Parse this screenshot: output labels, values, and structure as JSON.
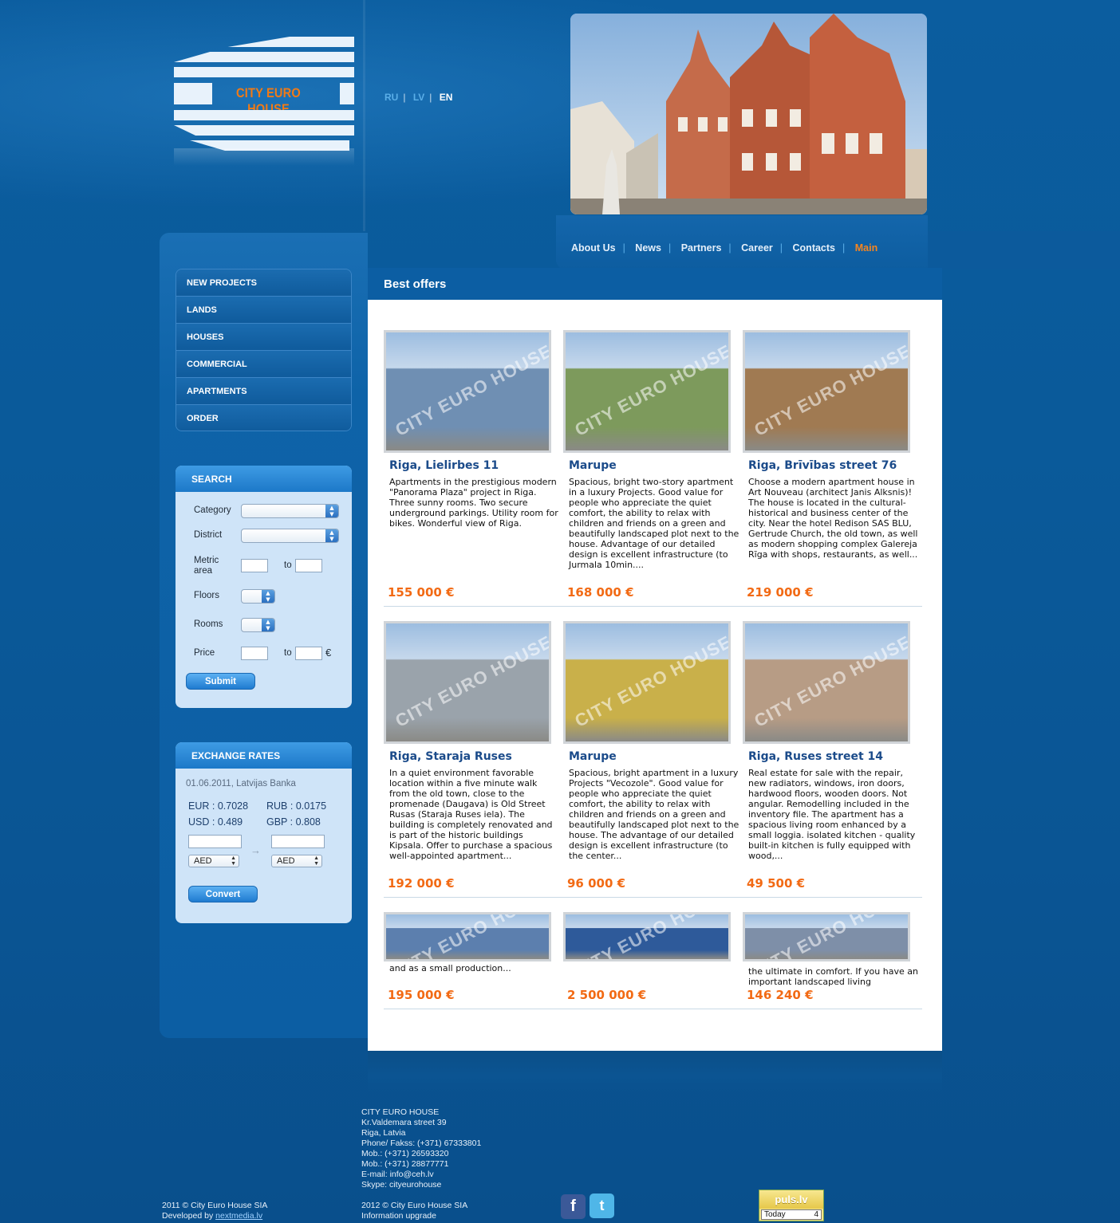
{
  "brand": {
    "logo_text": "CITY EURO HOUSE"
  },
  "languages": [
    "RU",
    "LV",
    "EN"
  ],
  "active_language": "EN",
  "nav": {
    "items": [
      "About Us",
      "News",
      "Partners",
      "Career",
      "Contacts",
      "Main"
    ],
    "active": "Main"
  },
  "categories": [
    "NEW PROJECTS",
    "LANDS",
    "HOUSES",
    "COMMERCIAL",
    "APARTMENTS",
    "ORDER"
  ],
  "search": {
    "title": "SEARCH",
    "category_label": "Category",
    "district_label": "District",
    "metric_label_1": "Metric",
    "metric_label_2": "area",
    "to_label": "to",
    "floors_label": "Floors",
    "rooms_label": "Rooms",
    "price_label": "Price",
    "currency_symbol": "€",
    "submit_label": "Submit"
  },
  "exchange": {
    "title": "EXCHANGE RATES",
    "source": "01.06.2011, Latvijas Banka",
    "rates": [
      {
        "code": "EUR",
        "value": "0.7028"
      },
      {
        "code": "RUB",
        "value": "0.0175"
      },
      {
        "code": "USD",
        "value": "0.489"
      },
      {
        "code": "GBP",
        "value": "0.808"
      }
    ],
    "from_currency": "AED",
    "to_currency": "AED",
    "arrow": "→",
    "convert_label": "Convert"
  },
  "best_offers_title": "Best offers",
  "watermark": "CITY EURO HOUSE",
  "offers": [
    {
      "title": "Riga, Lielirbes 11",
      "desc": "Apartments in the prestigious modern \"Panorama Plaza\" project in Riga. Three sunny rooms. Two secure underground parkings. Utility room for bikes. Wonderful view of Riga.",
      "price": "155 000 €",
      "tone": "#6f8fb3"
    },
    {
      "title": "Marupe",
      "desc": "Spacious, bright two-story apartment in a luxury Projects. Good value for people who appreciate the quiet comfort, the ability to relax with children and friends on a green and beautifully landscaped plot next to the house. Advantage of our detailed design is excellent infrastructure (to Jurmala 10min....",
      "price": "168 000 €",
      "tone": "#7d9a5c"
    },
    {
      "title": "Riga, Brīvības street 76",
      "desc": "Choose a modern apartment house in Art Nouveau (architect Janis Alksnis)! The house is located in the cultural-historical and business center of the city. Near the hotel Redison SAS BLU, Gertrude Church, the old town, as well as modern shopping complex Galereja Rīga with shops, restaurants, as well...",
      "price": "219 000 €",
      "tone": "#a07a52"
    },
    {
      "title": "Riga, Staraja Ruses",
      "desc": "In a quiet environment favorable location within a five minute walk from the old town, close to the promenade (Daugava) is Old Street Rusas (Staraja Ruses iela). The building is completely renovated and is part of the historic buildings Kipsala. Offer to purchase a spacious well-appointed apartment...",
      "price": "192 000 €",
      "tone": "#9aa3ab"
    },
    {
      "title": "Marupe",
      "desc": "Spacious, bright apartment in a luxury Projects \"Vecozole\". Good value for people who appreciate the quiet comfort, the ability to relax with children and friends on a green and beautifully landscaped plot next to the house. The advantage of our detailed design is excellent infrastructure (to the center...",
      "price": "96 000 €",
      "tone": "#c9b04a"
    },
    {
      "title": "Riga, Ruses street 14",
      "desc": "Real estate for sale with the repair, new radiators, windows, iron doors, hardwood floors, wooden doors. Not angular. Remodelling included in the inventory file. The apartment has a spacious living room enhanced by a small loggia. isolated kitchen - quality built-in kitchen is fully equipped with wood,...",
      "price": "49 500 €",
      "tone": "#b79c85"
    },
    {
      "title": "",
      "desc": "and as a small production...",
      "price": "195 000 €",
      "tone": "#5c7fae"
    },
    {
      "title": "",
      "desc": "",
      "price": "2 500 000 €",
      "tone": "#2e5a9a"
    },
    {
      "title": "",
      "desc": "the ultimate in comfort. If you have an important landscaped living",
      "price": "146 240 €",
      "tone": "#7e8fa8"
    }
  ],
  "footer": {
    "company": "CITY EURO HOUSE",
    "address_1": "Kr.Valdemara street 39",
    "address_2": "Riga, Latvia",
    "phone": "Phone/ Fakss: (+371) 67333801",
    "mob1": "Mob.: (+371) 26593320",
    "mob2": "Mob.: (+371) 28877771",
    "email": "E-mail: info@ceh.lv",
    "skype": "Skype: cityeurohouse",
    "copyright_2011": "2011 © City Euro House SIA",
    "developed_by": "Developed by",
    "developer": "nextmedia.lv",
    "copyright_2012": "2012 © City Euro House SIA",
    "upgrade": "Information upgrade",
    "counter_brand": "puls.lv",
    "counter_label": "Today",
    "counter_value": "4"
  }
}
